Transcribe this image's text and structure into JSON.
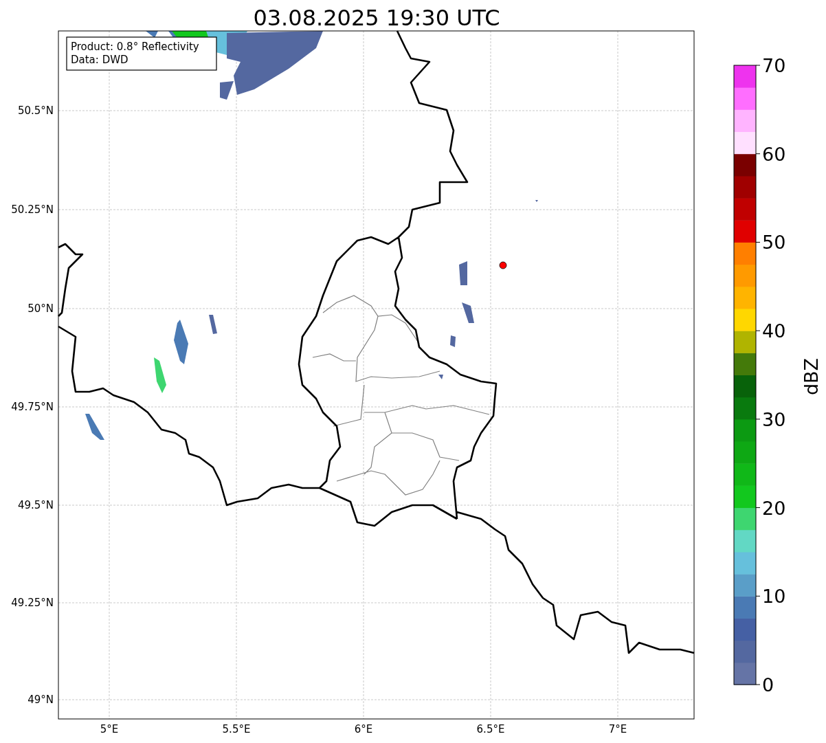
{
  "title": "03.08.2025 19:30 UTC",
  "map": {
    "info_box": [
      "Product: 0.8° Reflectivity",
      "Data: DWD"
    ],
    "lat_ticks": [
      "50.5°N",
      "50.25°N",
      "50°N",
      "49.75°N",
      "49.5°N",
      "49.25°N",
      "49°N"
    ],
    "lon_ticks": [
      "5°E",
      "5.5°E",
      "6°E",
      "6.5°E",
      "7°E"
    ]
  },
  "colorbar": {
    "label": "dBZ",
    "ticks": [
      "70",
      "60",
      "50",
      "40",
      "30",
      "20",
      "10",
      "0"
    ],
    "segments": [
      {
        "color": "#6574a6"
      },
      {
        "color": "#5468a0"
      },
      {
        "color": "#4560a4"
      },
      {
        "color": "#4a7ab4"
      },
      {
        "color": "#5a9ec8"
      },
      {
        "color": "#66c0dc"
      },
      {
        "color": "#62d8c4"
      },
      {
        "color": "#3ed670"
      },
      {
        "color": "#12c81e"
      },
      {
        "color": "#10b818"
      },
      {
        "color": "#0ea814"
      },
      {
        "color": "#0c9a12"
      },
      {
        "color": "#097a0e"
      },
      {
        "color": "#08620a"
      },
      {
        "color": "#447a0a"
      },
      {
        "color": "#b0b400"
      },
      {
        "color": "#ffd700"
      },
      {
        "color": "#ffb400"
      },
      {
        "color": "#ff9a00"
      },
      {
        "color": "#ff7f00"
      },
      {
        "color": "#e00000"
      },
      {
        "color": "#c00000"
      },
      {
        "color": "#a00000"
      },
      {
        "color": "#7a0000"
      },
      {
        "color": "#ffe0ff"
      },
      {
        "color": "#ffb4ff"
      },
      {
        "color": "#ff6eff"
      },
      {
        "color": "#ee33ee"
      }
    ]
  }
}
